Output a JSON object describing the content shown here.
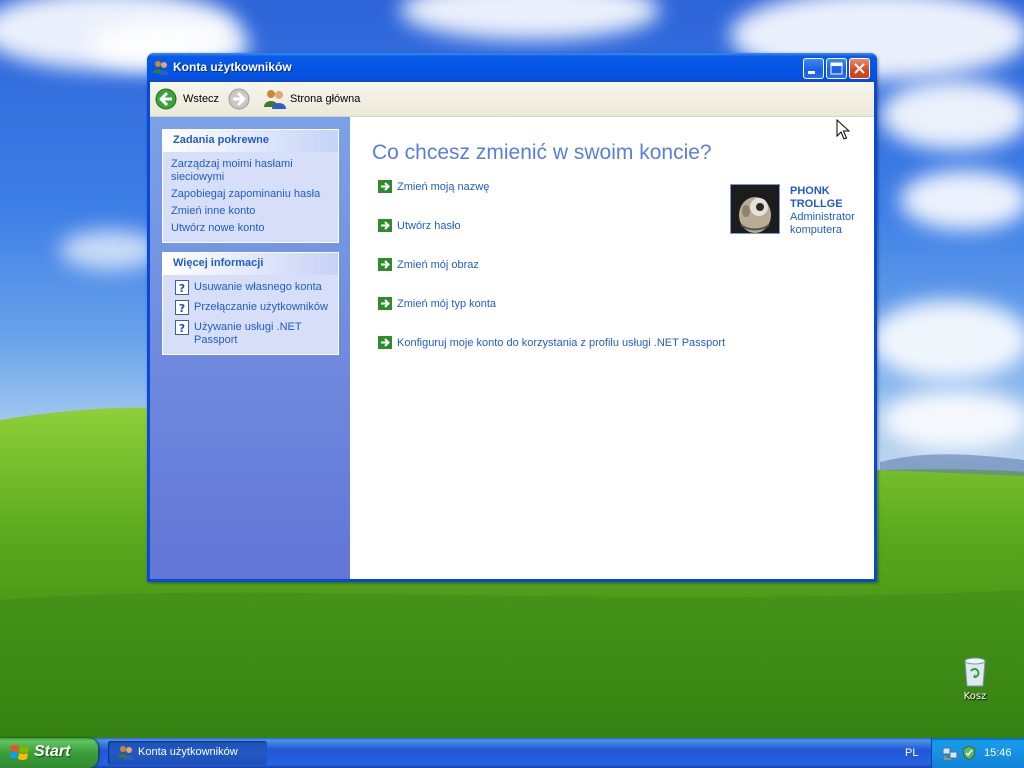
{
  "window": {
    "title": "Konta użytkowników"
  },
  "toolbar": {
    "back_label": "Wstecz",
    "home_label": "Strona główna"
  },
  "sidebar": {
    "related_tasks": {
      "title": "Zadania pokrewne",
      "items": [
        {
          "label": "Zarządzaj moimi hasłami sieciowymi"
        },
        {
          "label": "Zapobiegaj zapominaniu hasła"
        },
        {
          "label": "Zmień inne konto"
        },
        {
          "label": "Utwórz nowe konto"
        }
      ]
    },
    "more_info": {
      "title": "Więcej informacji",
      "items": [
        {
          "label": "Usuwanie własnego konta"
        },
        {
          "label": "Przełączanie użytkowników"
        },
        {
          "label": "Używanie usługi .NET Passport"
        }
      ]
    }
  },
  "main": {
    "heading": "Co chcesz zmienić w swoim koncie?",
    "actions": [
      {
        "label": "Zmień moją nazwę"
      },
      {
        "label": "Utwórz hasło"
      },
      {
        "label": "Zmień mój obraz"
      },
      {
        "label": "Zmień mój typ konta"
      },
      {
        "label": "Konfiguruj moje konto do korzystania z profilu usługi .NET Passport"
      }
    ],
    "user": {
      "name": "PHONK TROLLGE",
      "role": "Administrator komputera"
    }
  },
  "desktop": {
    "recycle_bin_label": "Kosz"
  },
  "taskbar": {
    "start_label": "Start",
    "window_button_label": "Konta użytkowników",
    "language": "PL",
    "clock": "15:46"
  },
  "colors": {
    "link": "#215dc6",
    "heading": "#5a7edc",
    "titlebar": "#0353e2",
    "start_green": "#3a9e3a"
  },
  "icons": {
    "back": "green-back-arrow-icon",
    "forward": "gray-forward-arrow-icon",
    "home": "users-icon",
    "help": "question-mark-icon",
    "action": "green-arrow-icon"
  }
}
